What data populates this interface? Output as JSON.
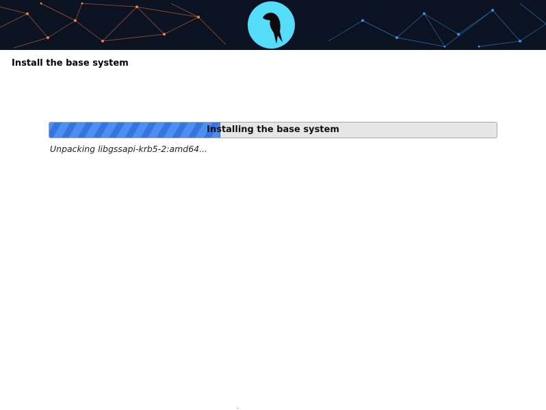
{
  "header": {
    "logo_icon": "parrot-logo-icon",
    "logo_color": "#55dcfb"
  },
  "page": {
    "title": "Install the base system"
  },
  "progress": {
    "label": "Installing the base system",
    "percent": 38
  },
  "status": {
    "text": "Unpacking libgssapi-krb5-2:amd64..."
  },
  "colors": {
    "banner_bg": "#0b1322",
    "progress_fill": "#4d8ff0",
    "progress_track": "#e6e6e6"
  }
}
